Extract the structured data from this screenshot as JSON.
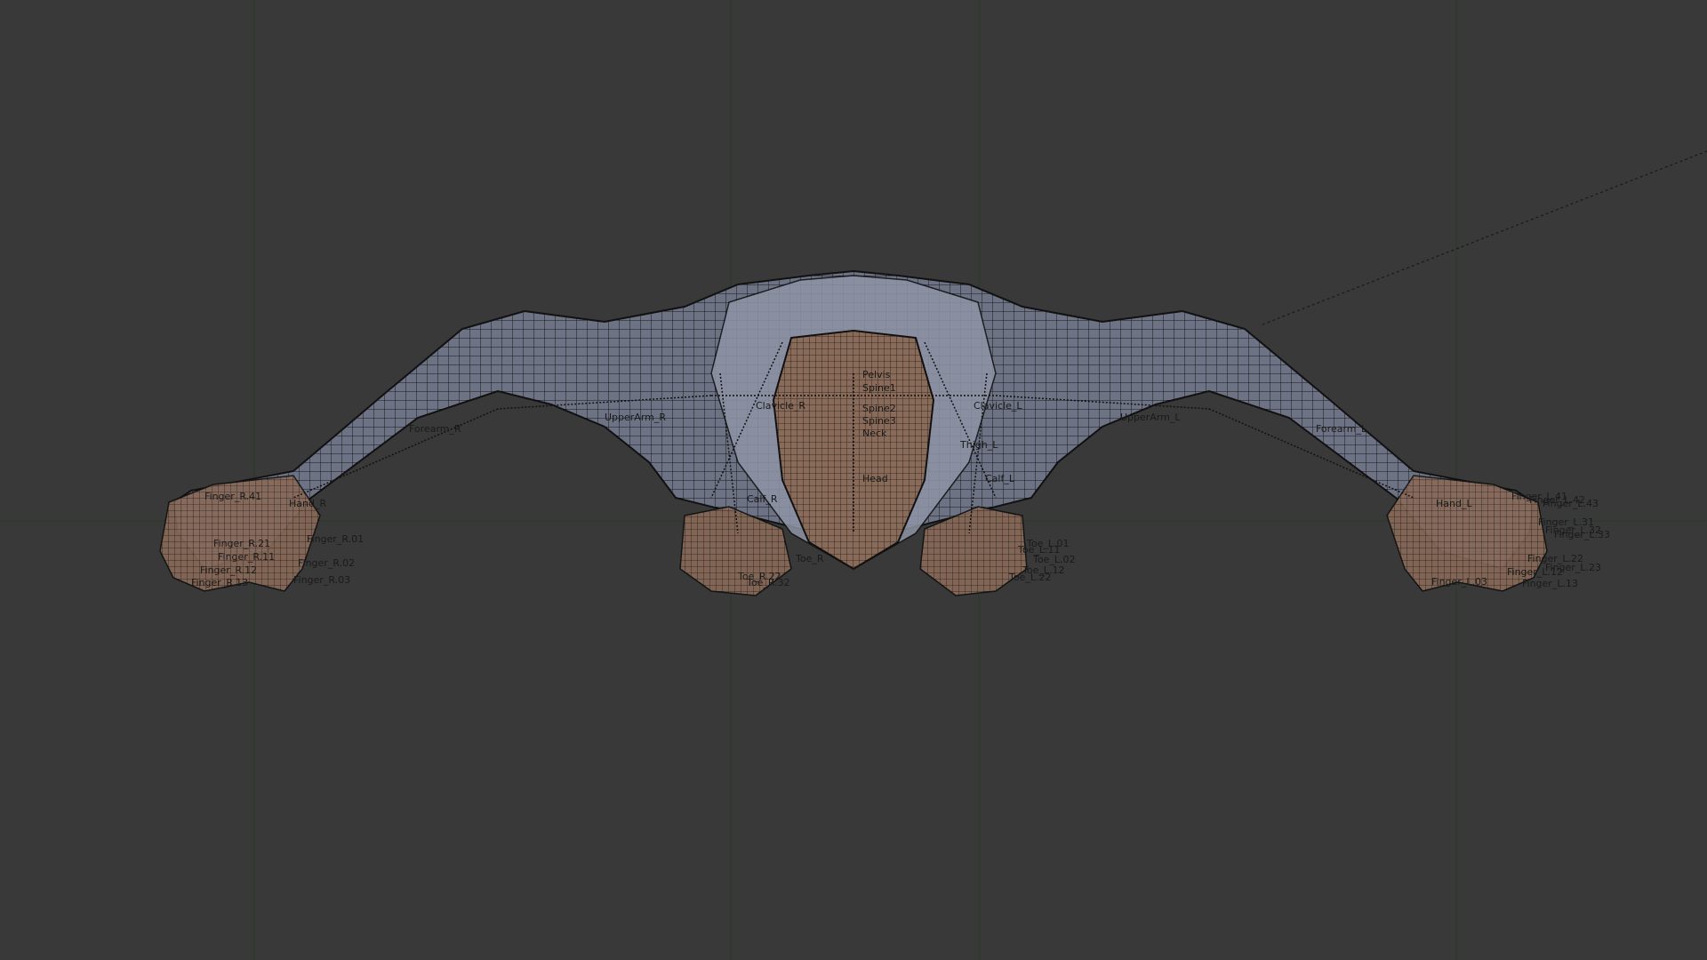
{
  "viewport": {
    "background": "#393939",
    "grid_color": "#2c3a2c",
    "mesh_fill": "#6a7080",
    "mesh_line": "#151515",
    "skin_tone": "#8a6a55"
  },
  "bone_labels": [
    "Pelvis",
    "Spine1",
    "Spine2",
    "Spine3",
    "Neck",
    "Head",
    "Clavicle_R",
    "Clavicle_L",
    "UpperArm_R",
    "UpperArm_L",
    "Forearm_R",
    "Forearm_L",
    "Hand_R",
    "Hand_L",
    "Finger_R.01",
    "Finger_R.02",
    "Finger_R.03",
    "Finger_R.11",
    "Finger_R.12",
    "Finger_R.13",
    "Finger_R.21",
    "Finger_R.41",
    "Finger_L.41",
    "Finger_L.42",
    "Finger_L.43",
    "Finger_L.31",
    "Finger_L.32",
    "Finger_L.33",
    "Finger_L.22",
    "Finger_L.23",
    "Finger_L.12",
    "Finger_L.13",
    "Finger_L.03",
    "Thigh_L",
    "Calf_L",
    "Calf_R",
    "Toe_L.01",
    "Toe_L.02",
    "Toe_L.11",
    "Toe_L.12",
    "Toe_L.22",
    "Toe_R.32",
    "Toe_R.22",
    "Toe_R"
  ]
}
